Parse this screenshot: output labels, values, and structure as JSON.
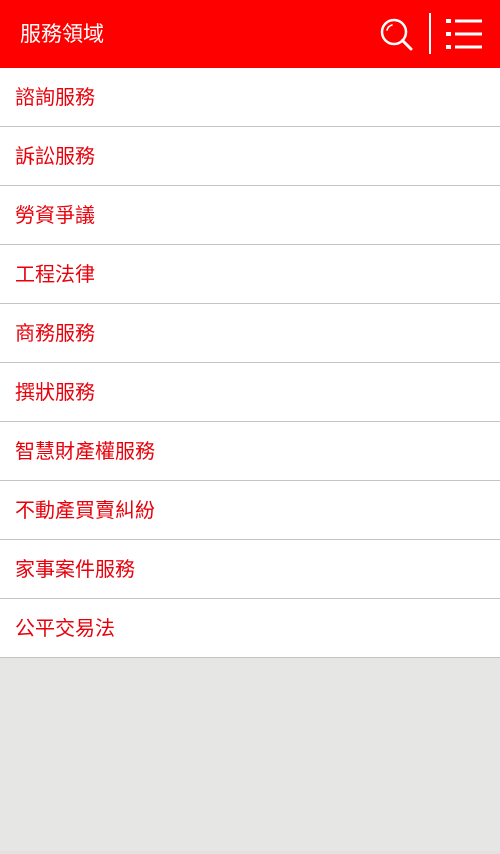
{
  "header": {
    "title": "服務領域",
    "search_icon": "search-icon",
    "menu_icon": "list-menu-icon"
  },
  "services": [
    {
      "label": "諮詢服務"
    },
    {
      "label": "訴訟服務"
    },
    {
      "label": "勞資爭議"
    },
    {
      "label": "工程法律"
    },
    {
      "label": "商務服務"
    },
    {
      "label": "撰狀服務"
    },
    {
      "label": "智慧財產權服務"
    },
    {
      "label": "不動產買賣糾紛"
    },
    {
      "label": "家事案件服務"
    },
    {
      "label": "公平交易法"
    }
  ],
  "colors": {
    "header_bg": "#ff0000",
    "item_text": "#e8000b",
    "divider": "#c4c4c4",
    "page_bg": "#e6e6e5"
  }
}
